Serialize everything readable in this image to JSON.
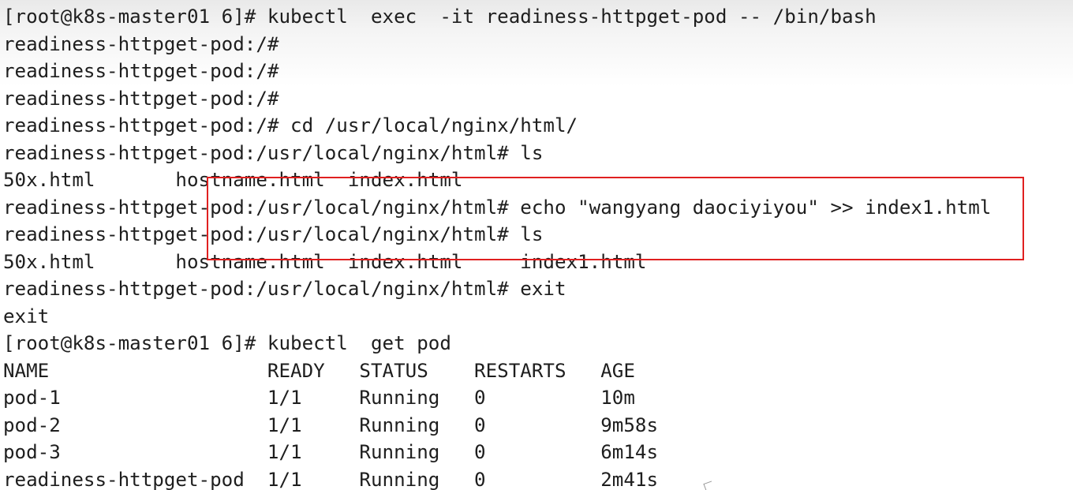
{
  "terminal": {
    "lines": [
      "[root@k8s-master01 6]# kubectl  exec  -it readiness-httpget-pod -- /bin/bash",
      "readiness-httpget-pod:/#",
      "readiness-httpget-pod:/#",
      "readiness-httpget-pod:/#",
      "readiness-httpget-pod:/# cd /usr/local/nginx/html/",
      "readiness-httpget-pod:/usr/local/nginx/html# ls",
      "50x.html       hostname.html  index.html",
      "readiness-httpget-pod:/usr/local/nginx/html# echo \"wangyang daociyiyou\" >> index1.html",
      "readiness-httpget-pod:/usr/local/nginx/html# ls",
      "50x.html       hostname.html  index.html     index1.html",
      "readiness-httpget-pod:/usr/local/nginx/html# exit",
      "exit",
      "[root@k8s-master01 6]# kubectl  get pod",
      "NAME                   READY   STATUS    RESTARTS   AGE",
      "pod-1                  1/1     Running   0          10m",
      "pod-2                  1/1     Running   0          9m58s",
      "pod-3                  1/1     Running   0          6m14s",
      "readiness-httpget-pod  1/1     Running   0          2m41s"
    ]
  },
  "colors": {
    "text": "#1e1e1e",
    "background": "#ffffff",
    "highlight_border": "#e02020"
  }
}
